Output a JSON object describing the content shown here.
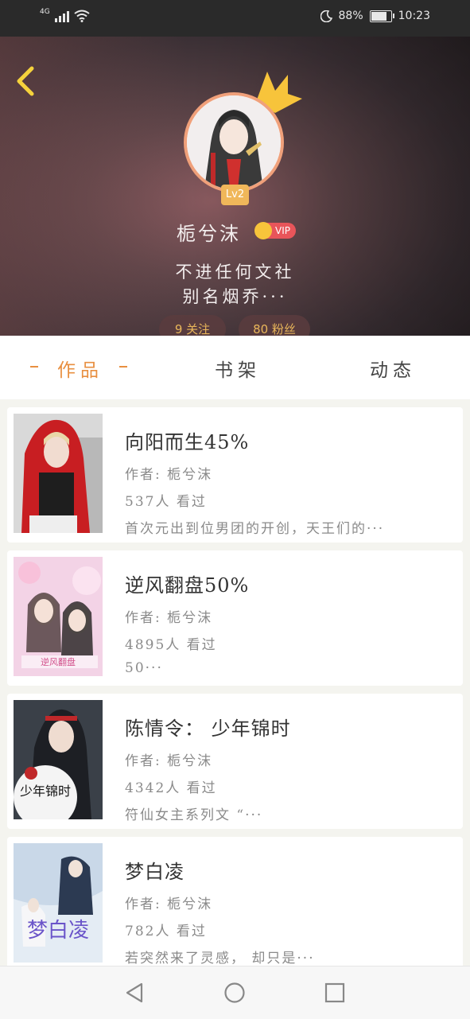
{
  "status_bar": {
    "network": "4G",
    "battery": "88%",
    "battery_level": 0.88,
    "time": "10:23"
  },
  "profile": {
    "name": "栀兮沫",
    "level": "Lv2",
    "vip_label": "VIP",
    "bio_line1": "不进任何文社",
    "bio_line2": "别名烟乔···",
    "following_label": "9 关注",
    "followers_label": "80 粉丝"
  },
  "tabs": [
    {
      "label": "作品",
      "active": true
    },
    {
      "label": "书架",
      "active": false
    },
    {
      "label": "动态",
      "active": false
    }
  ],
  "works": [
    {
      "title": "向阳而生45%",
      "author": "作者: 栀兮沫",
      "views": "537人 看过",
      "summary": "首次元出到位男团的开创，天王们的···"
    },
    {
      "title": "逆风翻盘50%",
      "author": "作者: 栀兮沫",
      "views": "4895人 看过",
      "summary": "50···"
    },
    {
      "title": "陈情令： 少年锦时",
      "author": "作者: 栀兮沫",
      "views": "4342人 看过",
      "summary": "符仙女主系列文  “···"
    },
    {
      "title": "梦白凌",
      "author": "作者: 栀兮沫",
      "views": "782人 看过",
      "summary": "若突然来了灵感， 却只是···"
    }
  ],
  "colors": {
    "accent": "#e88f40",
    "vip": "#e8555a",
    "level_badge": "#f0b75a"
  }
}
